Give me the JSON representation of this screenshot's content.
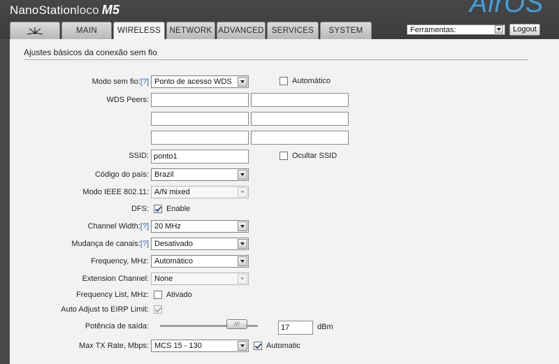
{
  "header": {
    "brand_main": "NanoStation",
    "brand_light": "loco",
    "brand_model": "M5",
    "logo_text": "AirOS"
  },
  "tabs": [
    {
      "label": ""
    },
    {
      "label": "MAIN"
    },
    {
      "label": "WIRELESS"
    },
    {
      "label": "NETWORK"
    },
    {
      "label": "ADVANCED"
    },
    {
      "label": "SERVICES"
    },
    {
      "label": "SYSTEM"
    }
  ],
  "active_tab": "WIRELESS",
  "tools": {
    "selected": "Ferramentas:",
    "logout_label": "Logout"
  },
  "section_title": "Ajustes básicos da conexão sem fio",
  "help": "[?]",
  "form": {
    "wireless_mode": {
      "label": "Modo sem fio:",
      "value": "Ponto de acesso WDS"
    },
    "auto": {
      "label": "Automático",
      "checked": false
    },
    "wds_peers": {
      "label": "WDS Peers:",
      "values": [
        "",
        "",
        "",
        "",
        "",
        ""
      ]
    },
    "ssid": {
      "label": "SSID:",
      "value": "ponto1"
    },
    "hide_ssid": {
      "label": "Ocultar SSID",
      "checked": false
    },
    "country": {
      "label": "Código do país:",
      "value": "Brazil"
    },
    "ieee_mode": {
      "label": "Modo IEEE 802.11:",
      "value": "A/N mixed"
    },
    "dfs": {
      "label": "DFS:",
      "checkbox_label": "Enable",
      "checked": true
    },
    "channel_width": {
      "label": "Channel Width:",
      "value": "20 MHz"
    },
    "channel_shift": {
      "label": "Mudança de canais:",
      "value": "Desativado"
    },
    "frequency": {
      "label": "Frequency, MHz:",
      "value": "Automático"
    },
    "extension_channel": {
      "label": "Extension Channel:",
      "value": "None"
    },
    "frequency_list": {
      "label": "Frequency List, MHz:",
      "checkbox_label": "Ativado",
      "checked": false
    },
    "auto_adjust_eirp": {
      "label": "Auto Adjust to EIRP Limit:",
      "checked": true
    },
    "output_power": {
      "label": "Potência de saída:",
      "value": "17",
      "unit": "dBm",
      "slider_level": 0.9
    },
    "max_tx_rate": {
      "label": "Max TX Rate, Mbps:",
      "value": "MCS 15 - 130",
      "auto_label": "Automatic",
      "auto_checked": true
    }
  }
}
